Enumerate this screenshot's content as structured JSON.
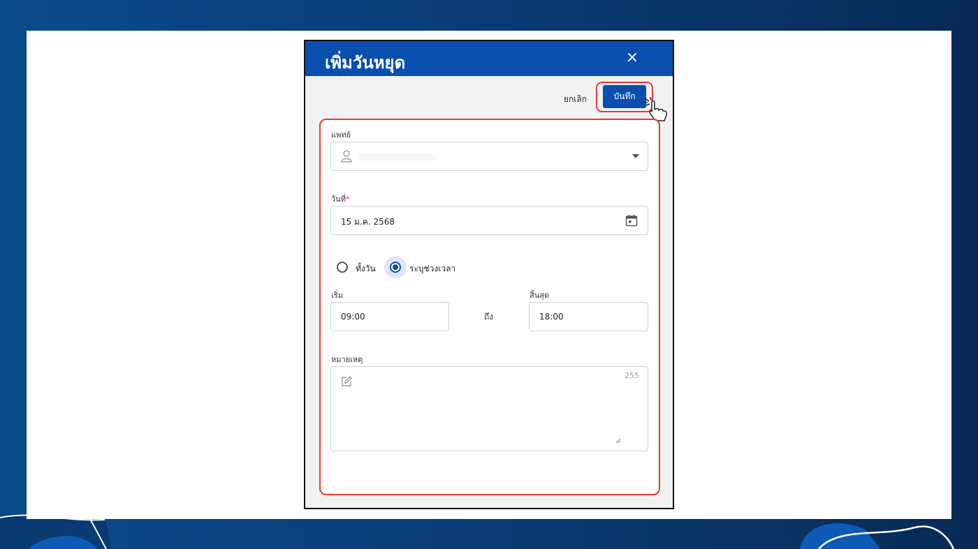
{
  "dialog": {
    "title": "เพิ่มวันหยุด",
    "close_icon": "×",
    "cancel_label": "ยกเลิก",
    "save_label": "บันทึก"
  },
  "form": {
    "doctor": {
      "label": "แพทย์",
      "value": ""
    },
    "date": {
      "label": "วันที่",
      "required_mark": "*",
      "value": "15 ม.ค. 2568"
    },
    "radio_options": [
      {
        "label": "ทั้งวัน",
        "selected": false
      },
      {
        "label": "ระบุช่วงเวลา",
        "selected": true
      }
    ],
    "start": {
      "label": "เริ่ม",
      "value": "09:00"
    },
    "to_label": "ถึง",
    "end": {
      "label": "สิ้นสุด",
      "value": "18:00"
    },
    "note": {
      "label": "หมายเหตุ",
      "counter": "255",
      "value": ""
    }
  },
  "colors": {
    "primary": "#0b4fae",
    "highlight": "#e53935"
  },
  "icons": [
    "close-icon",
    "user-icon",
    "caret-down-icon",
    "calendar-icon",
    "edit-icon",
    "resize-handle-icon",
    "pointer-cursor-icon"
  ]
}
